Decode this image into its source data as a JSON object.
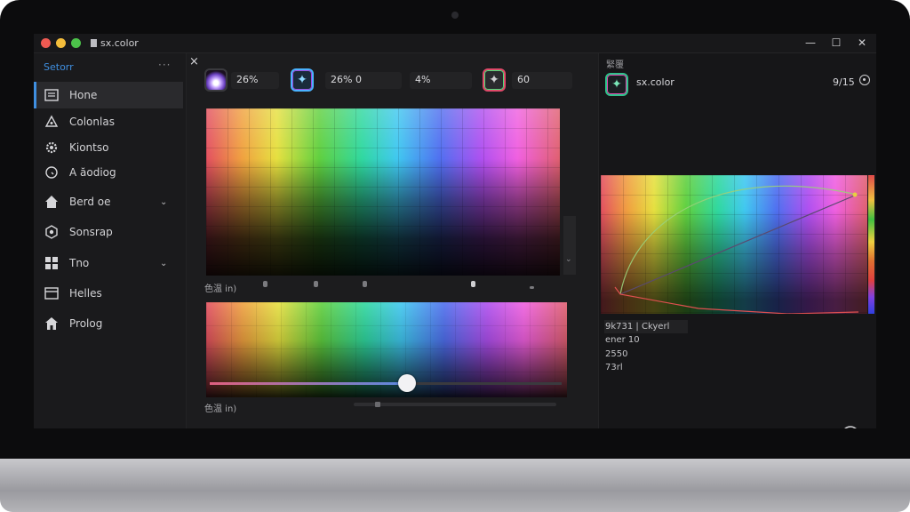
{
  "window": {
    "title": "sx.color"
  },
  "sidebar": {
    "title": "Setorr",
    "more": "···",
    "items": [
      {
        "label": "Hone",
        "icon": "grid-icon",
        "active": true
      },
      {
        "label": "Colonlas",
        "icon": "palette-icon"
      },
      {
        "label": "Kiontso",
        "icon": "gear-icon"
      },
      {
        "label": "A ăodiog",
        "icon": "clock-icon"
      },
      {
        "label": "Berd oe",
        "icon": "home-icon",
        "chevron": true
      },
      {
        "label": "Sonsrap",
        "icon": "hexagon-icon"
      },
      {
        "label": "Tno",
        "icon": "grid4-icon",
        "chevron": true
      },
      {
        "label": "Helles",
        "icon": "window-icon"
      },
      {
        "label": "Prolog",
        "icon": "house-icon"
      }
    ]
  },
  "toolbar": {
    "close": "×",
    "fields": [
      "26%",
      "26%  0",
      "4%",
      "60"
    ]
  },
  "main": {
    "upper_label": "色温 in)",
    "lower_label": "色温 in)",
    "scroll_arrow": "⌄",
    "slider": {
      "value": 0.56
    }
  },
  "right_panel": {
    "title": "緊覆",
    "name": "sx.color",
    "counter": "9/15",
    "stats": [
      "9k731 | Ckyerl",
      "ener 10",
      "2550",
      "73rl"
    ]
  },
  "colors": {
    "accent": "#3f8fe0",
    "background": "#1c1c1e"
  }
}
